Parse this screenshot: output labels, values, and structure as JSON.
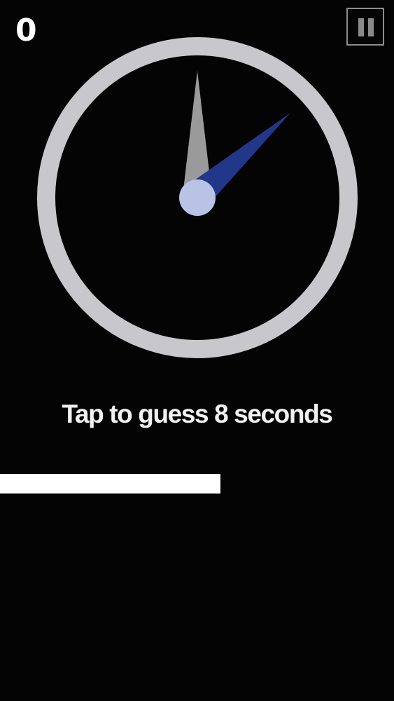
{
  "score": "0",
  "pause": {
    "icon": "pause-icon"
  },
  "clock": {
    "ring_color": "#c8c8cc",
    "face_color": "#040404",
    "second_hand_color": "#9a9a9a",
    "guess_hand_color": "#22378a",
    "hub_color": "#b9c3e6"
  },
  "prompt": "Tap to guess 8 seconds",
  "timer_bar": {
    "progress": 0.56,
    "color": "#ffffff"
  }
}
